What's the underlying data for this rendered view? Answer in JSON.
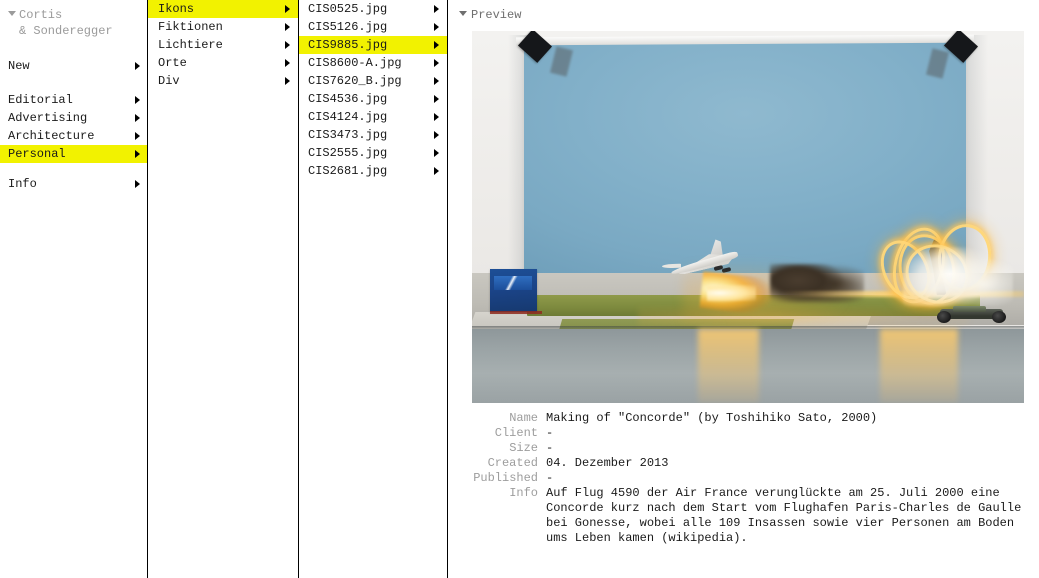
{
  "nav": {
    "brand_line1": "Cortis",
    "brand_line2": "& Sonderegger",
    "items": [
      {
        "label": "New",
        "selected": false
      },
      {
        "label": "Editorial",
        "selected": false
      },
      {
        "label": "Advertising",
        "selected": false
      },
      {
        "label": "Architecture",
        "selected": false
      },
      {
        "label": "Personal",
        "selected": true
      },
      {
        "label": "Info",
        "selected": false
      }
    ]
  },
  "categories": {
    "items": [
      {
        "label": "Ikons",
        "selected": true
      },
      {
        "label": "Fiktionen",
        "selected": false
      },
      {
        "label": "Lichtiere",
        "selected": false
      },
      {
        "label": "Orte",
        "selected": false
      },
      {
        "label": "Div",
        "selected": false
      }
    ]
  },
  "files": {
    "items": [
      {
        "label": "CIS0525.jpg",
        "selected": false
      },
      {
        "label": "CIS5126.jpg",
        "selected": false
      },
      {
        "label": "CIS9885.jpg",
        "selected": true
      },
      {
        "label": "CIS8600-A.jpg",
        "selected": false
      },
      {
        "label": "CIS7620_B.jpg",
        "selected": false
      },
      {
        "label": "CIS4536.jpg",
        "selected": false
      },
      {
        "label": "CIS4124.jpg",
        "selected": false
      },
      {
        "label": "CIS3473.jpg",
        "selected": false
      },
      {
        "label": "CIS2555.jpg",
        "selected": false
      },
      {
        "label": "CIS2681.jpg",
        "selected": false
      }
    ]
  },
  "preview": {
    "header": "Preview",
    "image_alt": "Studio miniature set: model Concorde with flame trail crashing beside a blue backdrop, dark smoke, yellow light-painting loops, white cotton smoke and a model car on a reflective surface",
    "metadata": [
      {
        "label": "Name",
        "value": "Making of \"Concorde\" (by Toshihiko Sato, 2000)"
      },
      {
        "label": "Client",
        "value": "-"
      },
      {
        "label": "Size",
        "value": "-"
      },
      {
        "label": "Created",
        "value": "04. Dezember 2013"
      },
      {
        "label": "Published",
        "value": "-"
      },
      {
        "label": "Info",
        "value": "Auf Flug 4590 der Air France verunglückte am 25. Juli 2000 eine Concorde kurz nach dem Start vom Flughafen Paris-Charles de Gaulle bei Gonesse, wobei alle 109 Insassen sowie vier Personen am Boden ums Leben kamen (wikipedia)."
      }
    ]
  },
  "colors": {
    "highlight": "#f2f200",
    "text": "#1a1a1a",
    "muted": "#9d9d9d",
    "divider": "#000000"
  }
}
